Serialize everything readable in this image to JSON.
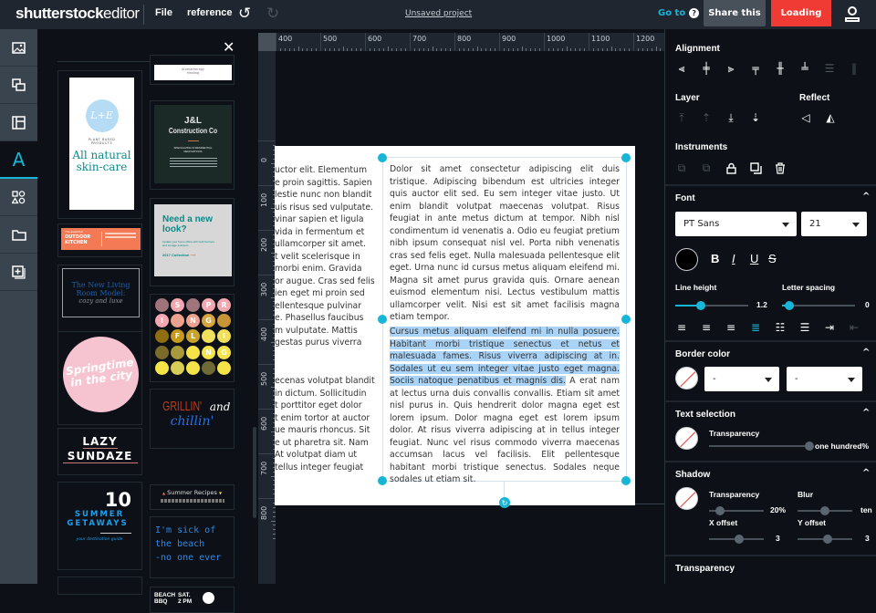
{
  "topbar": {
    "logo_bold": "shutterstock",
    "logo_light": "editor",
    "menu_file": "File",
    "menu_reference": "reference",
    "project_status": "Unsaved project",
    "goto_label": "Go to",
    "help_glyph": "?",
    "share_label": "Share this",
    "loading_label": "Loading",
    "icons": [
      "undo-icon",
      "redo-icon",
      "help-icon",
      "user-icon"
    ]
  },
  "leftnav": {
    "items": [
      {
        "name": "images",
        "icon": "image-icon"
      },
      {
        "name": "elements",
        "icon": "layers-icon"
      },
      {
        "name": "templates",
        "icon": "layout-icon"
      },
      {
        "name": "text",
        "icon": "text-icon",
        "glyph": "A",
        "active": true
      },
      {
        "name": "shapes",
        "icon": "shapes-icon"
      },
      {
        "name": "uploads",
        "icon": "folder-icon"
      },
      {
        "name": "add",
        "icon": "add-page-icon"
      }
    ]
  },
  "text_panel": {
    "close_glyph": "✕",
    "templates": {
      "aromatherapy": {
        "title": "Aromatherapy",
        "subtitle": "Healing"
      },
      "skincare": {
        "logo": "L+E",
        "tag1": "PLANT BASED",
        "tag2": "PRODUCTS",
        "headline1": "All natural",
        "headline2": "skin-care"
      },
      "construction": {
        "line1": "J&L",
        "line2": "Construction Co",
        "tag": "SPECIALIZING IN RESIDENTIAL RENOVATIONS"
      },
      "outdoor": {
        "script": "The essential",
        "line1": "OUTDOOR",
        "line2": "KITCHEN"
      },
      "newlook": {
        "headline1": "Need a new",
        "headline2": "look?",
        "body": "Update your home office with bold furniture and storage solutions",
        "cta": "2017 Collection"
      },
      "livingroom": {
        "line1": "The New Living",
        "line2": "Room Model:",
        "line3": "cozy and luxe"
      },
      "springfling": {
        "letters": [
          "",
          "S",
          "",
          "P",
          "R",
          "I",
          "",
          "N",
          "G",
          "",
          "",
          "F",
          "L",
          "",
          "I",
          "",
          "",
          "",
          "N",
          "G",
          "",
          "",
          "",
          "",
          ""
        ]
      },
      "springtime": {
        "line1": "Springtime",
        "line2": "in the city"
      },
      "grillin": {
        "word1": "GRILLIN'",
        "word2": "and",
        "word3": "chillin'"
      },
      "lazy": {
        "line1": "LAZY",
        "line2": "SUNDAZE"
      },
      "recipes": {
        "title": "Summer Recipes"
      },
      "getaways": {
        "num": "10",
        "line1": "SUMMER",
        "line2": "GETAWAYS",
        "sub": "your destination guide"
      },
      "beach_quote": {
        "line1": "I'm sick of",
        "line2": "the beach",
        "line3": "-no one ever"
      },
      "bbq": {
        "line1": "BEACH",
        "line2": "BBQ",
        "day": "SAT.",
        "time": "2 PM"
      }
    }
  },
  "canvas": {
    "ruler_top": [
      "400",
      "500",
      "600",
      "700",
      "800",
      "900",
      "1000",
      "1100",
      "1200"
    ],
    "ruler_left": [
      "0",
      "100",
      "200",
      "300",
      "400",
      "500",
      "600",
      "700",
      "800"
    ],
    "left_column_text_top": [
      "uctor elit. Elementum",
      "e proin sagittis. Sapien",
      "lestie nunc non blandit",
      "uis risus sed vulputate.",
      "vinar sapien et ligula",
      "vida in fermentum et",
      "ullamcorper sit amet.",
      "t velit scelerisque in",
      "morbi enim. Gravida",
      "or augue. Cras sed felis",
      "ien eget mi proin sed",
      "ellentesque pulvinar",
      "e. Phasellus faucibus",
      "m vulputate. Mattis",
      "gestas purus viverra"
    ],
    "left_column_text_bottom": [
      "ecenas volutpat blandit",
      "in dictum. Sollicitudin",
      "t porttitor eget dolor",
      "t enim tortor at auctor",
      "ue mauris rhoncus. Sit",
      "e ut pharetra sit. Nam",
      "At volutpat diam ut",
      "tellus integer feugiat"
    ],
    "paragraph1": "Dolor sit amet consectetur adipiscing elit duis tristique. Adipiscing bibendum est ultricies integer quis auctor elit sed. Eu sem integer vitae justo. Ut enim blandit volutpat maecenas volutpat. Risus feugiat in ante metus dictum at tempor. Nibh nisl condimentum id venenatis a. Odio eu feugiat pretium nibh ipsum consequat nisl vel. Porta nibh venenatis cras sed felis eget. Nulla malesuada pellentesque elit eget. Urna nunc id cursus metus aliquam eleifend mi. Magna sit amet purus gravida quis. Ornare aenean euismod elementum nisi. Lectus vestibulum mattis ullamcorper velit. Nisi est sit amet facilisis magna etiam tempor.",
    "paragraph2_selected": "Cursus metus aliquam eleifend mi in nulla posuere. Habitant morbi tristique senectus et netus et malesuada fames. Risus viverra adipiscing at in. Sodales ut eu sem integer vitae justo eget magna. Sociis natoque penatibus et magnis dis.",
    "paragraph2_rest": " A erat nam at lectus urna duis convallis convallis. Etiam sit amet nisl purus in. Quis hendrerit dolor magna eget est lorem ipsum. Dolor magna eget est lorem ipsum dolor. At risus viverra adipiscing at in tellus integer feugiat. Nunc vel risus commodo viverra maecenas accumsan lacus vel facilisis. Elit pellentesque habitant morbi tristique senectus. Sodales neque sodales ut etiam sit.",
    "rotate_glyph": "↻"
  },
  "properties": {
    "alignment": {
      "title": "Alignment",
      "icons": [
        "align-left-icon",
        "align-center-h-icon",
        "align-right-icon",
        "align-top-icon",
        "align-middle-v-icon",
        "align-bottom-icon",
        "distribute-v-icon",
        "distribute-h-icon"
      ]
    },
    "layer": {
      "title": "Layer",
      "icons": [
        "bring-to-front-icon",
        "bring-forward-icon",
        "send-backward-icon",
        "send-to-back-icon"
      ]
    },
    "reflect": {
      "title": "Reflect",
      "icons": [
        "flip-horizontal-icon",
        "flip-vertical-icon"
      ]
    },
    "instruments": {
      "title": "Instruments",
      "icons": [
        "group-icon",
        "ungroup-icon",
        "lock-icon",
        "duplicate-icon",
        "delete-icon"
      ]
    },
    "font": {
      "title": "Font",
      "family": "PT Sans",
      "size": "21",
      "color": "#000000",
      "bold": "B",
      "italic": "I",
      "underline": "U",
      "strike": "S",
      "line_height_label": "Line height",
      "line_height_value": "1.2",
      "line_height_fraction": 0.35,
      "letter_spacing_label": "Letter spacing",
      "letter_spacing_value": "0",
      "letter_spacing_fraction": 0.1,
      "paragraph_icons": [
        "text-align-left-icon",
        "text-align-center-icon",
        "text-align-right-icon",
        "text-justify-icon",
        "bulleted-list-icon",
        "numbered-list-icon",
        "indent-icon",
        "outdent-icon"
      ],
      "active_align": "justify"
    },
    "border_color": {
      "title": "Border color",
      "style_value": "-",
      "width_value": "-"
    },
    "text_selection": {
      "title": "Text selection",
      "transparency_label": "Transparency",
      "transparency_value": "one hundred%",
      "transparency_fraction": 1.0
    },
    "shadow": {
      "title": "Shadow",
      "transparency_label": "Transparency",
      "transparency_value": "20%",
      "transparency_fraction": 0.2,
      "blur_label": "Blur",
      "blur_value": "ten",
      "blur_fraction": 0.5,
      "x_offset_label": "X offset",
      "x_offset_value": "3",
      "x_offset_fraction": 0.55,
      "y_offset_label": "Y offset",
      "y_offset_value": "3",
      "y_offset_fraction": 0.55
    },
    "transparency": {
      "title": "Transparency"
    }
  },
  "colors": {
    "accent": "#17b6d6",
    "danger": "#ef3b33",
    "selection": "#a9d3f7"
  }
}
